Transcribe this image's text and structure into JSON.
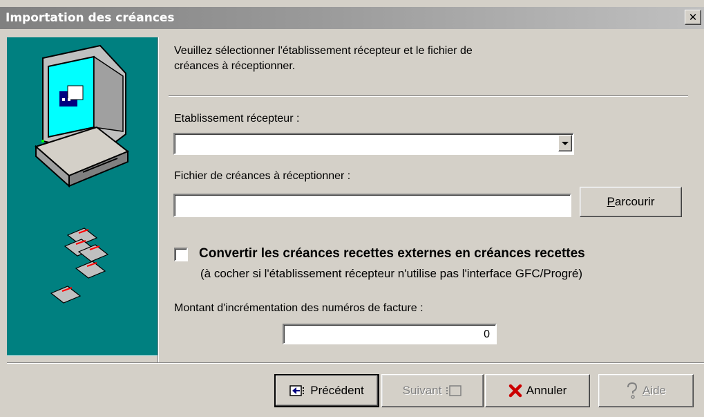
{
  "window": {
    "title": "Importation des créances",
    "close_glyph": "✕"
  },
  "intro": {
    "line1": "Veuillez sélectionner l'établissement récepteur et le fichier de",
    "line2": "créances à réceptionner."
  },
  "etablissement": {
    "label": "Etablissement récepteur :",
    "value": ""
  },
  "fichier": {
    "label": "Fichier de créances à réceptionner :",
    "value": ""
  },
  "browse": {
    "mnemonic": "P",
    "rest": "arcourir"
  },
  "convert": {
    "checked": false,
    "label": "Convertir les créances recettes externes en créances recettes",
    "note": "(à cocher si l'établissement récepteur n'utilise pas l'interface GFC/Progré)"
  },
  "increment": {
    "label": "Montant d'incrémentation des numéros de facture :",
    "value": "0"
  },
  "footer": {
    "prev_label": "Précédent",
    "next_label": "Suivant",
    "cancel_label": "Annuler",
    "help_mnemonic": "A",
    "help_rest": "ide"
  },
  "icons": [
    "computer-icon",
    "floppy-disk-icon",
    "prev-icon",
    "next-icon",
    "cancel-x-icon",
    "help-question-icon"
  ],
  "colors": {
    "side_panel": "#008080",
    "window": "#d4d0c8",
    "cancel_red": "#cc0000"
  }
}
